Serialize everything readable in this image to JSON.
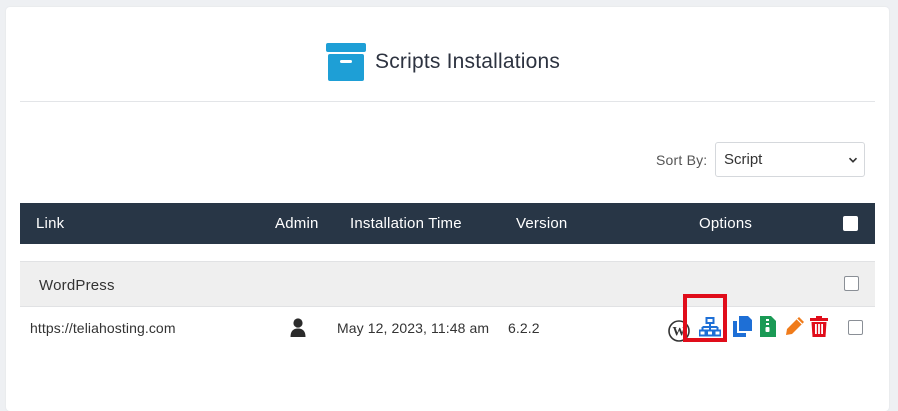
{
  "page": {
    "title": "Scripts Installations",
    "title_icon": "archive-box-icon",
    "accent_color": "#1e9fd6"
  },
  "sort": {
    "label": "Sort By:",
    "selected": "Script"
  },
  "table": {
    "columns": [
      "Link",
      "Admin",
      "Installation Time",
      "Version",
      "Options"
    ],
    "header_bg": "#283646",
    "groups": [
      {
        "name": "WordPress",
        "rows": [
          {
            "link": "https://teliahosting.com",
            "admin_icon": "user-icon",
            "installation_time": "May 12, 2023, 11:48 am",
            "version": "6.2.2",
            "options": [
              {
                "icon": "wordpress-icon",
                "color": "#333333"
              },
              {
                "icon": "sitemap-icon",
                "color": "#1e6fd6"
              },
              {
                "icon": "clone-icon",
                "color": "#1e6fd6"
              },
              {
                "icon": "backup-file-icon",
                "color": "#1a9a55"
              },
              {
                "icon": "edit-pencil-icon",
                "color": "#f07b1a"
              },
              {
                "icon": "trash-icon",
                "color": "#e00d1a"
              }
            ]
          }
        ]
      }
    ]
  }
}
